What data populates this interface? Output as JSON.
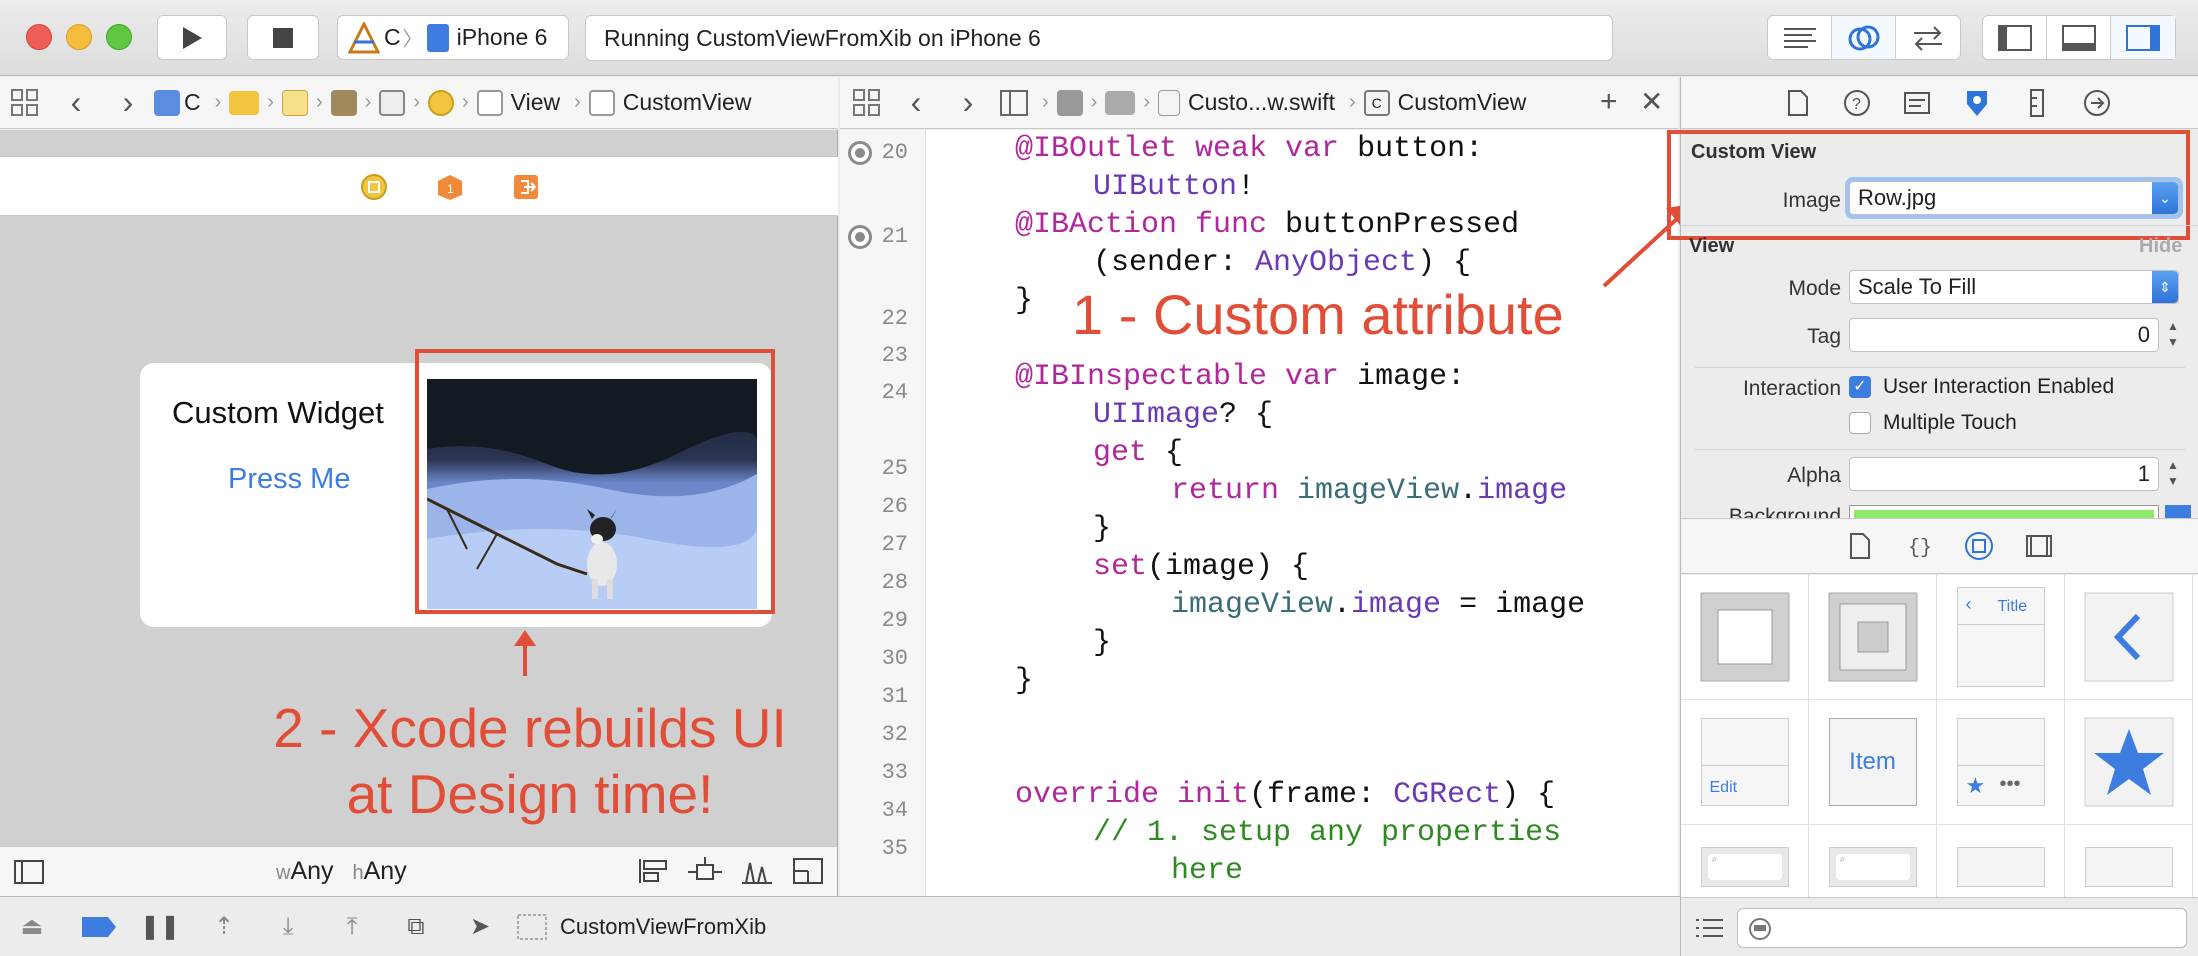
{
  "toolbar": {
    "scheme_project": "C",
    "scheme_device": "iPhone 6",
    "activity_status": "Running CustomViewFromXib on iPhone 6"
  },
  "ib_jumpbar": {
    "project_abbrev": "C",
    "view_label": "View",
    "customview_label": "CustomView"
  },
  "editor_jumpbar": {
    "file_name": "Custo...w.swift",
    "class_name": "CustomView"
  },
  "canvas": {
    "widget_title": "Custom Widget",
    "widget_button": "Press Me",
    "size_class_w_prefix": "w",
    "size_class_w": "Any",
    "size_class_h_prefix": "h",
    "size_class_h": "Any"
  },
  "annotations": {
    "custom_attribute": "1 - Custom attribute",
    "xcode_rebuilds_line1": "2 - Xcode rebuilds UI",
    "xcode_rebuilds_line2": "at Design time!"
  },
  "code": {
    "line_numbers": [
      "20",
      "21",
      "22",
      "23",
      "24",
      "25",
      "26",
      "27",
      "28",
      "29",
      "30",
      "31",
      "32",
      "33",
      "34",
      "35"
    ]
  },
  "inspector": {
    "custom_view_section": "Custom View",
    "image_label": "Image",
    "image_value": "Row.jpg",
    "view_section": "View",
    "hide_label": "Hide",
    "mode_label": "Mode",
    "mode_value": "Scale To Fill",
    "tag_label": "Tag",
    "tag_value": "0",
    "interaction_label": "Interaction",
    "user_interaction": "User Interaction Enabled",
    "multiple_touch": "Multiple Touch",
    "alpha_label": "Alpha",
    "alpha_value": "1",
    "background_label": "Background",
    "background_color": "#8ee86a"
  },
  "library": {
    "nav_title_label": "Title",
    "bar_item_label": "Item",
    "edit_label": "Edit"
  },
  "debugbar": {
    "process_name": "CustomViewFromXib"
  },
  "colors": {
    "accent": "#2f74d8",
    "annotation": "#e04e38",
    "keyword": "#b0289b",
    "type": "#6a3ab4"
  }
}
